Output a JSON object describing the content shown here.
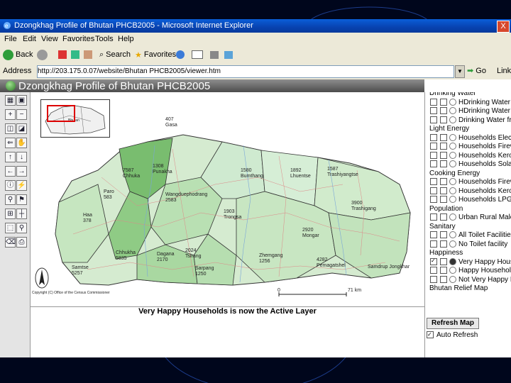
{
  "window": {
    "title": "Dzongkhag Profile of Bhutan PHCB2005 - Microsoft Internet Explorer",
    "close_glyph": "X"
  },
  "menu": [
    "File",
    "Edit",
    "View",
    "Favorites",
    "Tools",
    "Help"
  ],
  "toolbar": {
    "back": "Back",
    "search": "Search",
    "favorites": "Favorites"
  },
  "address": {
    "label": "Address",
    "url": "http://203.175.0.07/website/Bhutan PHCB2005/viewer.htm",
    "go": "Go",
    "links": "Links"
  },
  "page": {
    "header_title": "Dzongkhag Profile of Bhutan PHCB2005"
  },
  "map": {
    "labels": [
      {
        "id": "gasa",
        "lines": [
          "407",
          "Gasa"
        ]
      },
      {
        "id": "punakha",
        "lines": [
          "1308",
          "Punakha"
        ]
      },
      {
        "id": "chhuka",
        "lines": [
          "7587",
          "Chhuka"
        ]
      },
      {
        "id": "paro",
        "lines": [
          "Paro",
          "583"
        ]
      },
      {
        "id": "haa",
        "lines": [
          "Haa",
          "378"
        ]
      },
      {
        "id": "wangdue",
        "lines": [
          "Wangduephodrang",
          "2583"
        ]
      },
      {
        "id": "bumthang",
        "lines": [
          "1580",
          "Bumthang"
        ]
      },
      {
        "id": "lhuentse",
        "lines": [
          "1892",
          "Lhuentse"
        ]
      },
      {
        "id": "trashiyangtse",
        "lines": [
          "1587",
          "Trashiyangtse"
        ]
      },
      {
        "id": "trongsa",
        "lines": [
          "1903",
          "Trongsa"
        ]
      },
      {
        "id": "mongar",
        "lines": [
          "2920",
          "Mongar"
        ]
      },
      {
        "id": "trashigang",
        "lines": [
          "3900",
          "Trashigang"
        ]
      },
      {
        "id": "chhukha",
        "lines": [
          "Chhukha",
          "5835"
        ]
      },
      {
        "id": "dagana",
        "lines": [
          "Dagana",
          "2170"
        ]
      },
      {
        "id": "tsirang",
        "lines": [
          "2024",
          "Tsirang"
        ]
      },
      {
        "id": "sarpang",
        "lines": [
          "Sarpang",
          "1250"
        ]
      },
      {
        "id": "samtse",
        "lines": [
          "Samtse",
          "5257"
        ]
      },
      {
        "id": "zhemgang",
        "lines": [
          "Zhemgang",
          "1256"
        ]
      },
      {
        "id": "pemagatshel",
        "lines": [
          "4282",
          "Pemagatshel"
        ]
      },
      {
        "id": "samdrupjongkhar",
        "lines": [
          "Samdrup Jongkhar"
        ]
      }
    ],
    "copyright": "Copyright (C) Office of the Census Commissioner",
    "scale_start": "0",
    "scale_end": "71 km",
    "active_layer_message": "Very Happy Households is now the Active Layer",
    "overview_label": "Bhutan"
  },
  "layers": {
    "groups": [
      {
        "name": "Drinking Water",
        "items": [
          "HDrinking Water Insid",
          "HDrinking Water outs",
          "Drinking Water from C"
        ]
      },
      {
        "name": "Light Energy",
        "items": [
          "Households Electricity",
          "Households Firewood",
          "Households Kerosene",
          "Households Solar for L"
        ]
      },
      {
        "name": "Cooking Energy",
        "items": [
          "Households Firewood",
          "Households Kerosene",
          "Households LPG for Co"
        ]
      },
      {
        "name": "Population",
        "items": [
          "Urban Rural Male Fema"
        ]
      },
      {
        "name": "Sanitary",
        "items": [
          "All Toilet Facilities",
          "No Toilet facility"
        ]
      },
      {
        "name": "Happiness",
        "items": [
          "Very Happy Househol",
          "Happy Households",
          "Not Very Happy Housel"
        ]
      }
    ],
    "bottom_group": "Bhutan Relief Map",
    "refresh_label": "Refresh Map",
    "auto_refresh_label": "Auto Refresh"
  },
  "colors": {
    "map_light": "#c9e5c5",
    "map_mid": "#a6d39f",
    "map_dark": "#6fb768",
    "title_blue": "#0842b0"
  }
}
